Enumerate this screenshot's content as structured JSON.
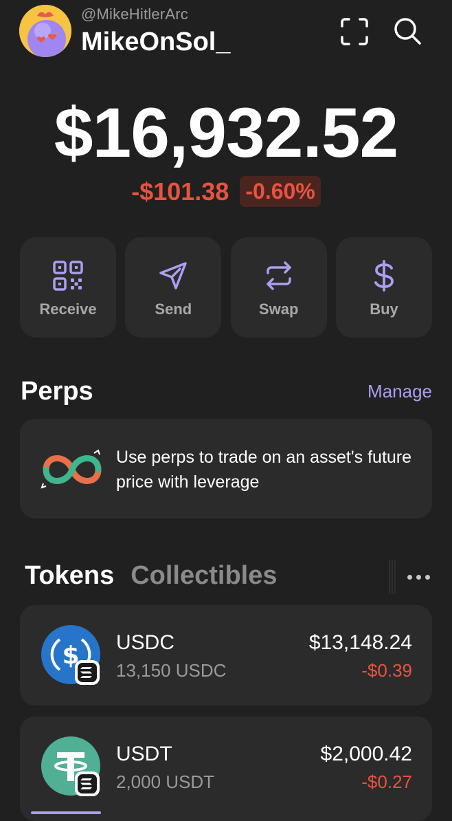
{
  "header": {
    "handle": "@MikeHitlerArc",
    "username": "MikeOnSol_",
    "avatar_icon": "rooster-avatar",
    "scan_icon": "scan-icon",
    "search_icon": "search-icon"
  },
  "balance": {
    "total": "$16,932.52",
    "change_abs": "-$101.38",
    "change_pct": "-0.60%"
  },
  "actions": [
    {
      "label": "Receive",
      "icon": "qr-code-icon"
    },
    {
      "label": "Send",
      "icon": "send-icon"
    },
    {
      "label": "Swap",
      "icon": "swap-icon"
    },
    {
      "label": "Buy",
      "icon": "dollar-icon"
    }
  ],
  "perps": {
    "title": "Perps",
    "manage": "Manage",
    "message": "Use perps to trade on an asset's future price with leverage",
    "logo_icon": "perps-infinity-icon"
  },
  "tabs": {
    "tokens": "Tokens",
    "collectibles": "Collectibles",
    "more_icon": "more-dots-icon"
  },
  "tokens": [
    {
      "name": "USDC",
      "amount": "13,150 USDC",
      "value": "$13,148.24",
      "change": "-$0.39",
      "icon": "usdc-icon",
      "chain_icon": "solana-badge-icon"
    },
    {
      "name": "USDT",
      "amount": "2,000 USDT",
      "value": "$2,000.42",
      "change": "-$0.27",
      "icon": "usdt-icon",
      "chain_icon": "solana-badge-icon"
    }
  ],
  "colors": {
    "background": "#202020",
    "card": "#2b2b2b",
    "accent": "#ab9ff2",
    "negative": "#e8533f",
    "usdc": "#2775ca",
    "usdt": "#50af95"
  }
}
